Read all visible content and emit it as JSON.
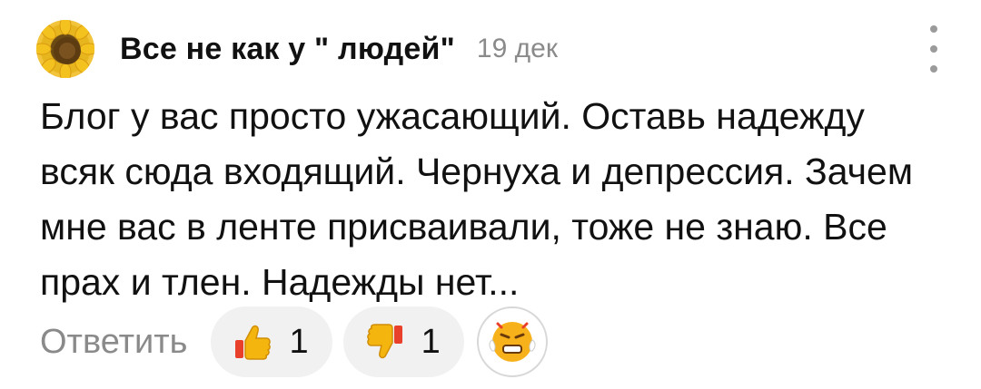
{
  "comment": {
    "author": "Все не как у \" людей\"",
    "date": "19 дек",
    "text": "Блог у вас просто ужасающий. Оставь надежду всяк сюда входящий. Чернуха и депрессия. Зачем мне вас в ленте присваивали, тоже не знаю. Все прах и тлен. Надежды нет..."
  },
  "actions": {
    "reply_label": "Ответить",
    "like": {
      "icon": "thumbs-up-icon",
      "count": "1"
    },
    "dislike": {
      "icon": "thumbs-down-icon",
      "count": "1"
    },
    "emoji": {
      "icon": "angry-face-emoji-icon"
    }
  },
  "colors": {
    "muted_text": "#8a8a8a",
    "pill_bg": "#f1f1f1",
    "thumb_yellow": "#f5b50f",
    "thumb_red": "#e8402b"
  }
}
